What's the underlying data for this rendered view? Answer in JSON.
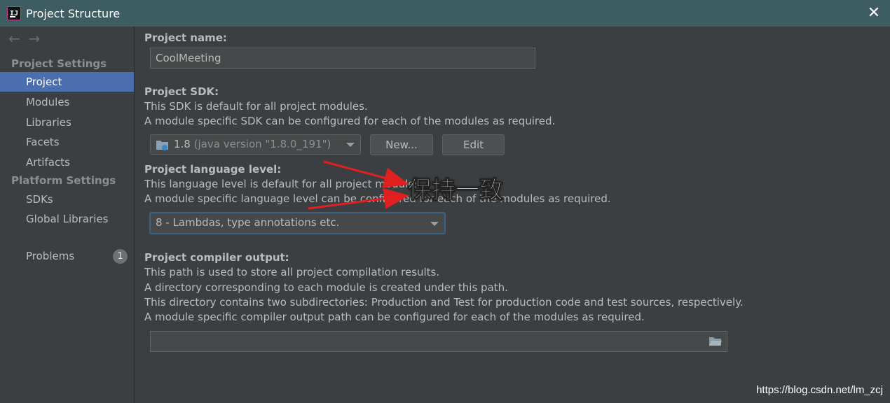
{
  "window": {
    "title": "Project Structure",
    "app_icon_text": "IJ"
  },
  "sidebar": {
    "sections": [
      {
        "heading": "Project Settings",
        "items": [
          {
            "label": "Project",
            "selected": true
          },
          {
            "label": "Modules"
          },
          {
            "label": "Libraries"
          },
          {
            "label": "Facets"
          },
          {
            "label": "Artifacts"
          }
        ]
      },
      {
        "heading": "Platform Settings",
        "items": [
          {
            "label": "SDKs"
          },
          {
            "label": "Global Libraries"
          }
        ]
      }
    ],
    "problems": {
      "label": "Problems",
      "count": "1"
    }
  },
  "project": {
    "name_label": "Project name:",
    "name_value": "CoolMeeting",
    "sdk_label": "Project SDK:",
    "sdk_desc_1": "This SDK is default for all project modules.",
    "sdk_desc_2": "A module specific SDK can be configured for each of the modules as required.",
    "sdk_version": "1.8",
    "sdk_detail": "(java version \"1.8.0_191\")",
    "new_button": "New...",
    "edit_button": "Edit",
    "lang_label": "Project language level:",
    "lang_desc_1": "This language level is default for all project modules.",
    "lang_desc_2": "A module specific language level can be configured for each of the modules as required.",
    "lang_value": "8 - Lambdas, type annotations etc.",
    "compiler_label": "Project compiler output:",
    "compiler_desc_1": "This path is used to store all project compilation results.",
    "compiler_desc_2": "A directory corresponding to each module is created under this path.",
    "compiler_desc_3": "This directory contains two subdirectories: Production and Test for production code and test sources, respectively.",
    "compiler_desc_4": "A module specific compiler output path can be configured for each of the modules as required.",
    "compiler_value": ""
  },
  "annotation": {
    "text": "保持一致",
    "color": "#e02020"
  },
  "watermark": "https://blog.csdn.net/lm_zcj"
}
